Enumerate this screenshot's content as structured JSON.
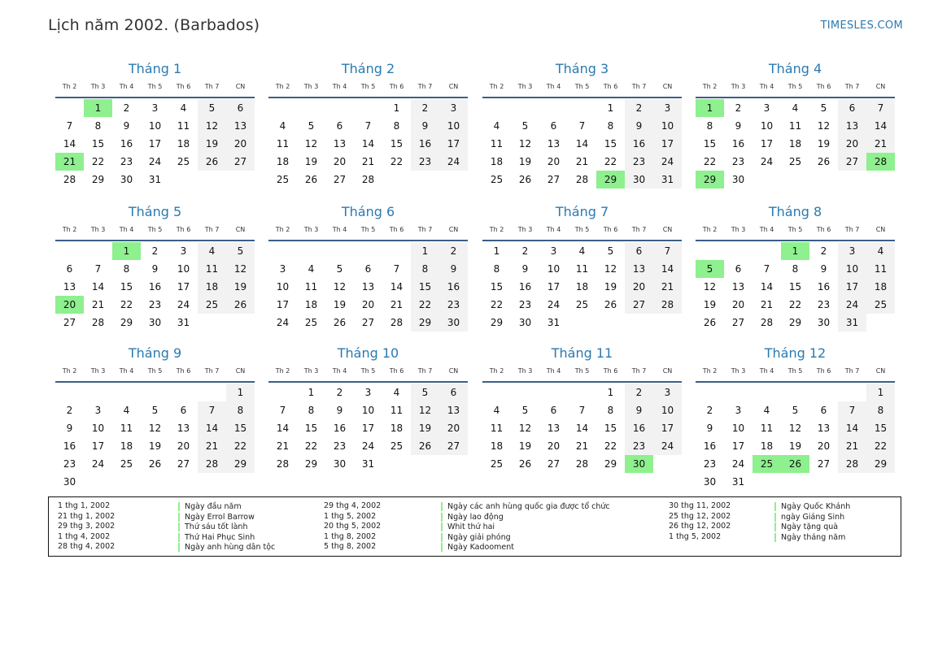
{
  "header": {
    "title": "Lịch năm 2002. (Barbados)",
    "site": "TIMESLES.COM"
  },
  "weekdays": [
    "Th 2",
    "Th 3",
    "Th 4",
    "Th 5",
    "Th 6",
    "Th 7",
    "CN"
  ],
  "months": [
    {
      "title": "Tháng 1",
      "offset": 1,
      "days": 31,
      "holidays": [
        1,
        21
      ]
    },
    {
      "title": "Tháng 2",
      "offset": 4,
      "days": 28,
      "holidays": []
    },
    {
      "title": "Tháng 3",
      "offset": 4,
      "days": 31,
      "holidays": [
        29
      ]
    },
    {
      "title": "Tháng 4",
      "offset": 0,
      "days": 30,
      "holidays": [
        1,
        28,
        29
      ]
    },
    {
      "title": "Tháng 5",
      "offset": 2,
      "days": 31,
      "holidays": [
        1,
        20
      ]
    },
    {
      "title": "Tháng 6",
      "offset": 5,
      "days": 30,
      "holidays": []
    },
    {
      "title": "Tháng 7",
      "offset": 0,
      "days": 31,
      "holidays": []
    },
    {
      "title": "Tháng 8",
      "offset": 3,
      "days": 31,
      "holidays": [
        1,
        5
      ]
    },
    {
      "title": "Tháng 9",
      "offset": 6,
      "days": 30,
      "holidays": []
    },
    {
      "title": "Tháng 10",
      "offset": 1,
      "days": 31,
      "holidays": []
    },
    {
      "title": "Tháng 11",
      "offset": 4,
      "days": 30,
      "holidays": [
        30
      ]
    },
    {
      "title": "Tháng 12",
      "offset": 6,
      "days": 31,
      "holidays": [
        25,
        26
      ]
    }
  ],
  "legend": [
    [
      {
        "date": "1 thg 1, 2002",
        "name": "Ngày đầu năm"
      },
      {
        "date": "21 thg 1, 2002",
        "name": "Ngày Errol Barrow"
      },
      {
        "date": "29 thg 3, 2002",
        "name": "Thứ sáu tốt lành"
      },
      {
        "date": "1 thg 4, 2002",
        "name": "Thứ Hai Phục Sinh"
      },
      {
        "date": "28 thg 4, 2002",
        "name": "Ngày anh hùng dân tộc"
      }
    ],
    [
      {
        "date": "29 thg 4, 2002",
        "name": "Ngày các anh hùng quốc gia được tổ chức"
      },
      {
        "date": "1 thg 5, 2002",
        "name": "Ngày lao động"
      },
      {
        "date": "20 thg 5, 2002",
        "name": "Whit thứ hai"
      },
      {
        "date": "1 thg 8, 2002",
        "name": "Ngày giải phóng"
      },
      {
        "date": "5 thg 8, 2002",
        "name": "Ngày Kadooment"
      }
    ],
    [
      {
        "date": "30 thg 11, 2002",
        "name": "Ngày Quốc Khánh"
      },
      {
        "date": "25 thg 12, 2002",
        "name": "ngày Giáng Sinh"
      },
      {
        "date": "26 thg 12, 2002",
        "name": "Ngày tặng quà"
      },
      {
        "date": "1 thg 5, 2002",
        "name": "Ngày tháng năm"
      }
    ]
  ],
  "colors": {
    "accent": "#2a7ab0",
    "holiday": "#8ef08e",
    "weekend": "#f2f2f2",
    "rule": "#3b5f88"
  }
}
